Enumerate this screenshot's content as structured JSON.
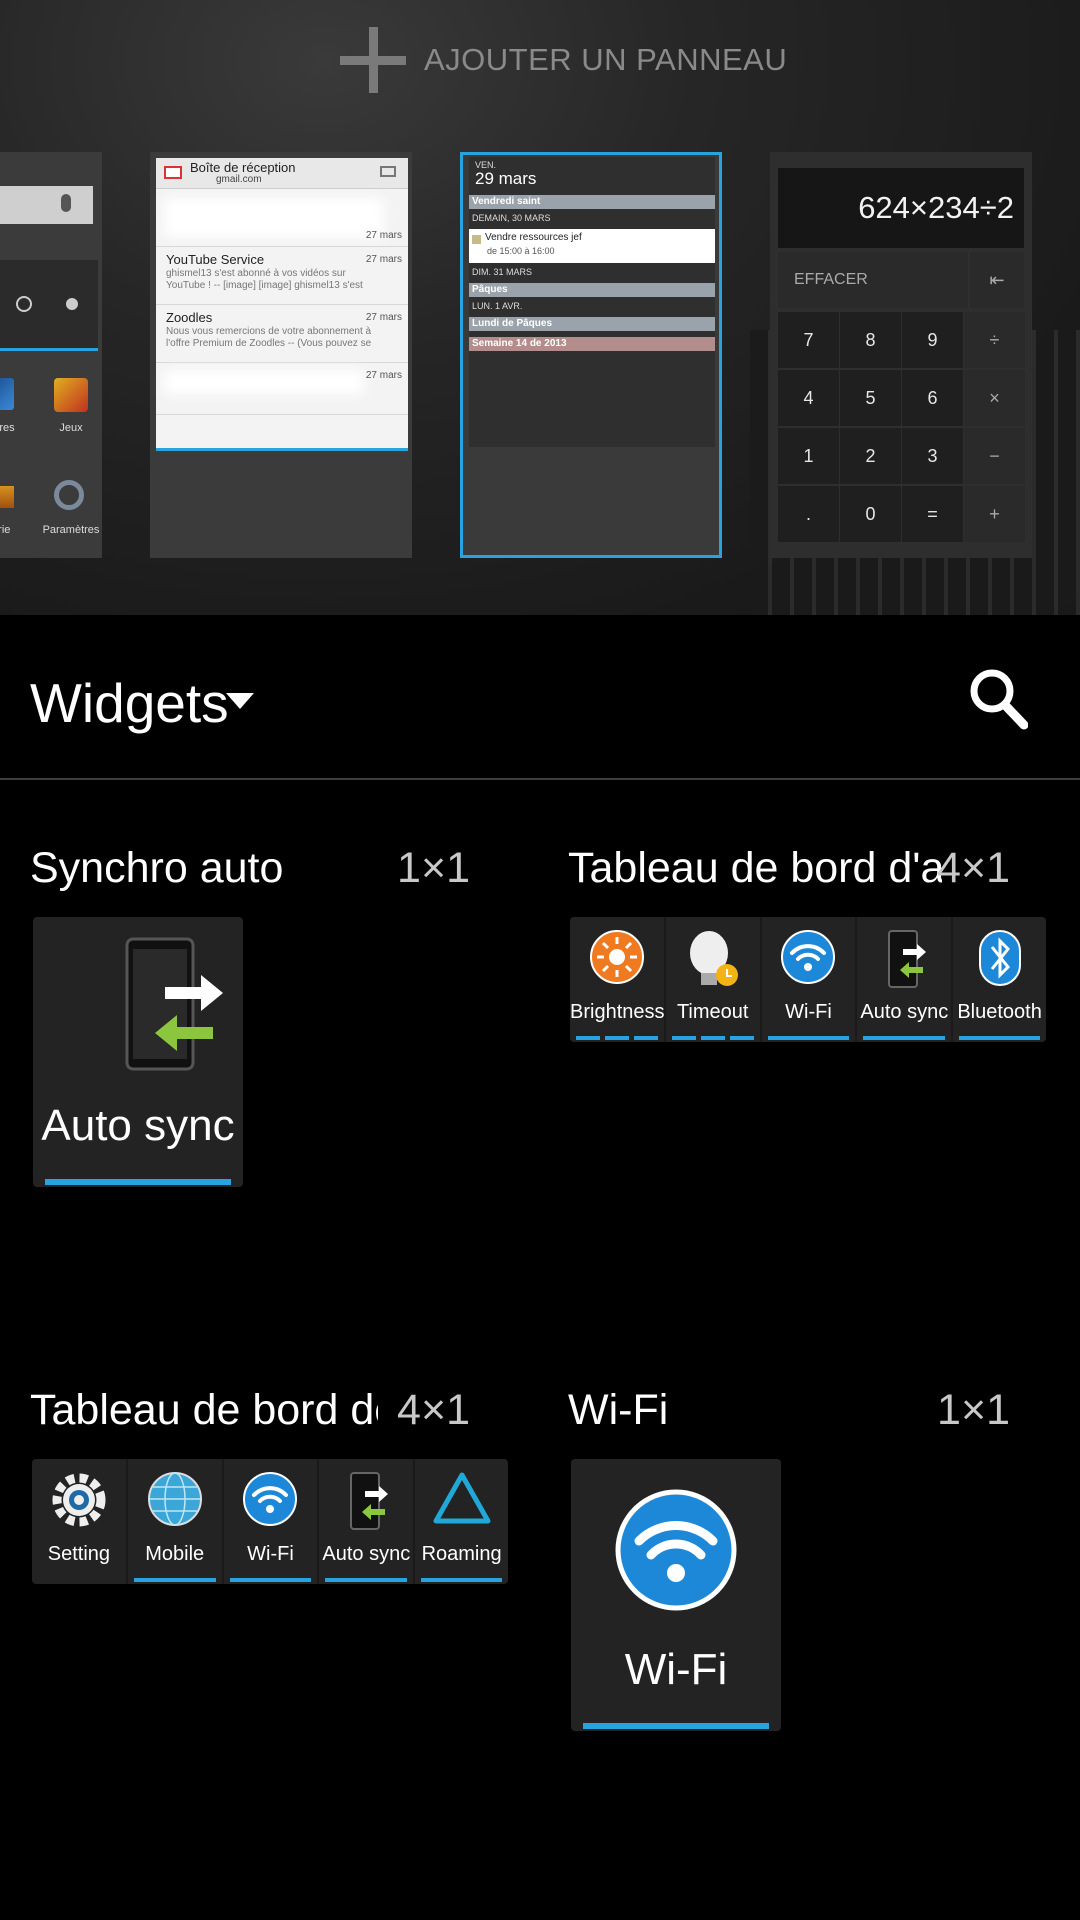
{
  "top": {
    "add_panel_label": "AJOUTER UN PANNEAU",
    "home_panel": {
      "apps": [
        {
          "label": "itaires",
          "icon": "app-icon"
        },
        {
          "label": "Jeux",
          "icon": "games-icon"
        },
        {
          "label": "lerie",
          "icon": "gallery-icon"
        },
        {
          "label": "Paramètres",
          "icon": "settings-icon"
        }
      ]
    },
    "gmail": {
      "title": "Boîte de réception",
      "account": "gmail.com",
      "messages": [
        {
          "sender": "",
          "snippet": "",
          "date": "27 mars"
        },
        {
          "sender": "YouTube Service",
          "snippet": "ghismel13 s'est abonné à vos vidéos sur YouTube ! -- [image] [image] ghismel13 s'est",
          "date": "27 mars"
        },
        {
          "sender": "Zoodles",
          "snippet": "Nous vous remercions de votre abonnement à l'offre Premium de Zoodles -- (Vous pouvez se",
          "date": "27 mars"
        },
        {
          "sender": "",
          "snippet": "",
          "date": "27 mars"
        }
      ]
    },
    "agenda": {
      "weekday": "VEN.",
      "date": "29 mars",
      "entries": [
        {
          "type": "bar",
          "text": "Vendredi saint",
          "color": "#9aa3ab"
        },
        {
          "type": "day",
          "text": "DEMAIN, 30 MARS"
        },
        {
          "type": "event",
          "title": "Vendre ressources jef",
          "time": "de 15:00 à 16:00"
        },
        {
          "type": "day",
          "text": "DIM. 31 MARS"
        },
        {
          "type": "bar",
          "text": "Pâques",
          "color": "#9aa3ab"
        },
        {
          "type": "day",
          "text": "LUN. 1 AVR."
        },
        {
          "type": "bar",
          "text": "Lundi de Pâques",
          "color": "#9aa3ab"
        },
        {
          "type": "bar",
          "text": "Semaine 14 de 2013",
          "color": "#b38c8c"
        }
      ]
    },
    "calculator": {
      "display": "624×234÷2",
      "clear_label": "EFFACER",
      "back_glyph": "⇤",
      "keys": [
        [
          "7",
          "8",
          "9",
          "÷"
        ],
        [
          "4",
          "5",
          "6",
          "×"
        ],
        [
          "1",
          "2",
          "3",
          "−"
        ],
        [
          ".",
          "0",
          "=",
          "+"
        ]
      ]
    }
  },
  "widgets_header": {
    "title": "Widgets"
  },
  "widgets": [
    {
      "title": "Synchro auto",
      "size": "1×1",
      "tile_label": "Auto sync"
    },
    {
      "title": "Tableau de bord d'alimentation",
      "size": "4×1",
      "cells": [
        "Brightness",
        "Timeout",
        "Wi-Fi",
        "Auto sync",
        "Bluetooth"
      ]
    },
    {
      "title": "Tableau de bord des",
      "size": "4×1",
      "cells": [
        "Setting",
        "Mobile",
        "Wi-Fi",
        "Auto sync",
        "Roaming"
      ]
    },
    {
      "title": "Wi-Fi",
      "size": "1×1",
      "tile_label": "Wi-Fi"
    }
  ],
  "colors": {
    "accent": "#29a3e0",
    "tile_bg": "#232323",
    "brightness": "#f07a20",
    "wifi": "#1e88d8"
  }
}
